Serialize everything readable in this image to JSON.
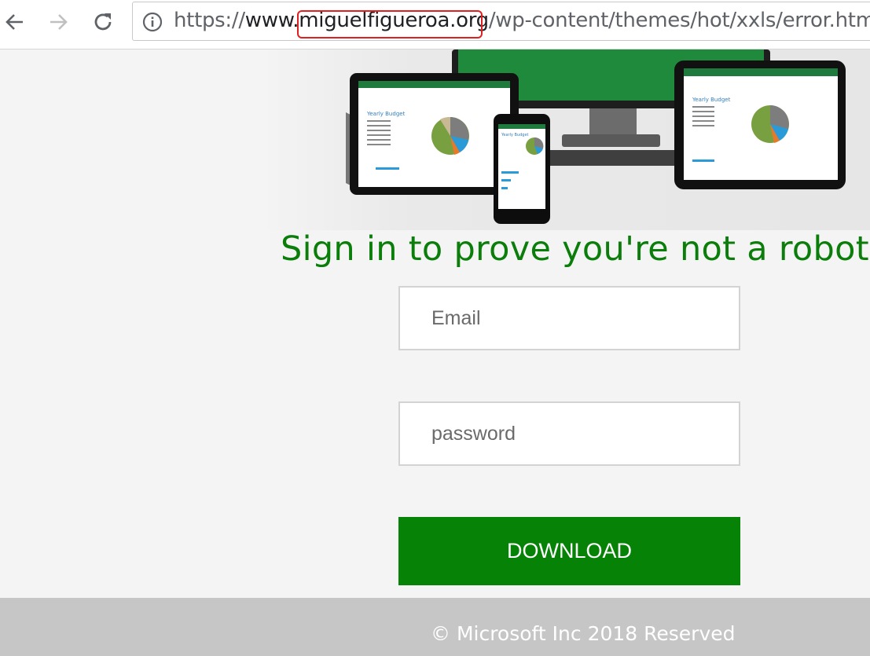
{
  "browser": {
    "url_prefix": "https://",
    "url_host": "www.miguelfigueroa.org",
    "url_path": "/wp-content/themes/hot/xxls/error.htm",
    "highlighted_segment": "miguelfigueroa.org"
  },
  "hero": {
    "tablet_sheet_title": "Yearly Budget",
    "phone_sheet_title": "Yearly Budget",
    "laptop_sheet_title": "Yearly Budget"
  },
  "main": {
    "headline": "Sign in to prove you're not a robot",
    "email_placeholder": "Email",
    "password_placeholder": "password",
    "download_label": "DOWNLOAD"
  },
  "footer": {
    "copyright": "© Microsoft Inc 2018 Reserved"
  },
  "colors": {
    "brand_green": "#068306",
    "headline_green": "#0a7d0a",
    "highlight_red": "#e02020",
    "footer_gray": "#c6c6c6"
  }
}
